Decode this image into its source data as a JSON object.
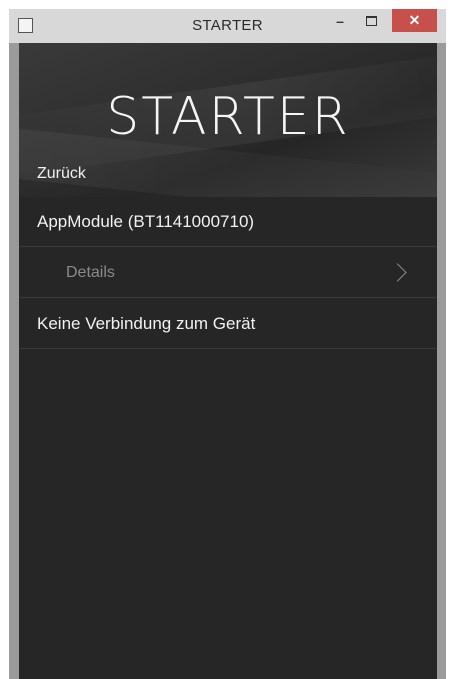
{
  "window": {
    "title": "STARTER",
    "controls": {
      "minimize": "–",
      "close": "✕"
    }
  },
  "app": {
    "banner_title": "STARTER",
    "back_label": "Zurück",
    "module_label": "AppModule (BT1141000710)",
    "details_label": "Details",
    "status_label": "Keine Verbindung zum Gerät"
  },
  "colors": {
    "background": "#262626",
    "close_button": "#c7504d",
    "titlebar": "#d8d8d8"
  }
}
